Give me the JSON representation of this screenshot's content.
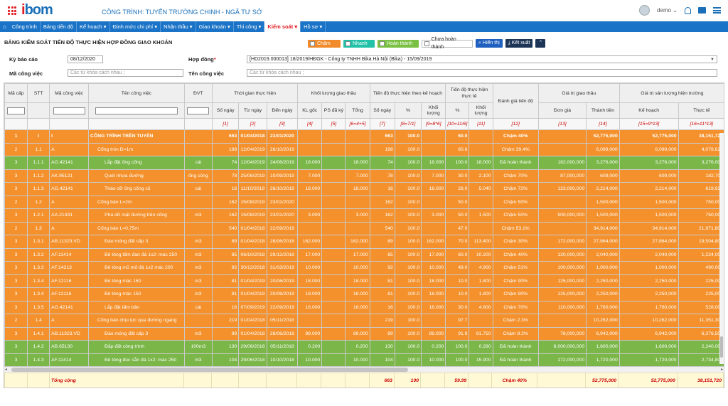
{
  "header": {
    "logo": "bom",
    "logo_prefix": "i",
    "project_title": "CÔNG TRÌNH: TUYẾN TRƯỜNG CHINH - NGÃ TƯ SỞ",
    "user_name": "demo",
    "user_caret": "⌄"
  },
  "nav": {
    "home_icon": "⌂",
    "items": [
      "Công trình",
      "Bảng tiến độ",
      "Kế hoạch ▾",
      "Định mức chi phí ▾",
      "Nhận thầu ▾",
      "Giao khoán ▾",
      "Thi công ▾",
      "Kiểm soát ▾",
      "Hồ sơ ▾"
    ],
    "active_index": 7
  },
  "page": {
    "title": "BẢNG KIỂM SOÁT TIẾN ĐỘ THỰC HIỆN HỢP ĐỒNG GIAO KHOÁN"
  },
  "legend": {
    "late": "Chậm",
    "fast": "Nhanh",
    "done": "Hoàn thành",
    "undone": "Chưa hoàn thành",
    "show_btn": "Hiển thị",
    "export_btn": "Kết xuất",
    "collapse_btn": "⌃",
    "colors": {
      "late": "#f08a2a",
      "fast": "#23c2a8",
      "done": "#7ac143"
    }
  },
  "form": {
    "period_label": "Kỳ báo cáo",
    "period_value": "08/12/2020",
    "contract_label": "Hợp đồng",
    "contract_required": "*",
    "contract_value": "[HD2019.000013] 18/2019/HĐGK - Công ty TNHH Bika Hà Nội (Bika) - 15/09/2019",
    "work_code_label": "Mã công việc",
    "work_code_placeholder": "Các từ khóa cách nhau ;",
    "work_name_label": "Tên công việc",
    "work_name_placeholder": "Các từ khóa cách nhau ;"
  },
  "table": {
    "headers": {
      "level": "Mã cấp",
      "stt": "STT",
      "code": "Mã công việc",
      "name": "Tên công việc",
      "unit": "ĐVT",
      "time": "Thời gian thực hiện",
      "time_days": "Số ngày",
      "time_from": "Từ ngày",
      "time_to": "Đến ngày",
      "qty": "Khối lượng giao thầu",
      "qty_orig": "KL gốc",
      "qty_add": "PS đã ký",
      "qty_total": "Tổng",
      "plan": "Tiến độ thực hiện theo kế hoạch",
      "plan_days": "Số ngày",
      "plan_pct": "%",
      "plan_qty": "Khối lượng",
      "actual": "Tiến độ thực hiện thực tế",
      "actual_pct": "%",
      "actual_qty": "Khối lượng",
      "eval": "Đánh giá tiến độ",
      "value": "Giá trị giao thầu",
      "unit_price": "Đơn giá",
      "amount": "Thành tiền",
      "prod": "Giá trị sản lượng hiện trường",
      "prod_plan": "Kế hoạch",
      "prod_actual": "Thực tế"
    },
    "col_index": [
      "",
      "",
      "",
      "",
      "",
      "[1]",
      "[2]",
      "[3]",
      "[4]",
      "[5]",
      "[6=4+5]",
      "[7]",
      "[8=7/1]",
      "[9=8*6]",
      "[10=11/6]",
      "[11]",
      "[12]",
      "[13]",
      "[14]",
      "[15=9*13]",
      "[16=11*13]"
    ],
    "rows": [
      {
        "s": "orange",
        "b": true,
        "c": [
          "1",
          "I",
          "I",
          "CÔNG TRÌNH TRÊN TUYẾN",
          "",
          "663",
          "01/04/2018",
          "23/01/2020",
          "",
          "",
          "",
          "663",
          "100.0",
          "",
          "60.0",
          "",
          "Chậm 40%",
          "",
          "52,775,000",
          "52,775,000",
          "38,151,720"
        ]
      },
      {
        "s": "orange",
        "c": [
          "2",
          "1.1",
          "A",
          "Cống tròn D=1m",
          "",
          "198",
          "12/04/2019",
          "26/10/2019",
          "",
          "",
          "",
          "198",
          "100.0",
          "",
          "60.6",
          "",
          "Chậm 39.4%",
          "",
          "6,099,000",
          "6,099,000",
          "4,078,620"
        ]
      },
      {
        "s": "green",
        "c": [
          "3",
          "1.1.1",
          "AG.42141",
          "Lắp đặt ống cống",
          "cái",
          "74",
          "12/04/2019",
          "24/06/2019",
          "18.000",
          "",
          "18.000",
          "74",
          "100.0",
          "18.000",
          "100.0",
          "18.000",
          "Đã hoàn thành",
          "182,000,000",
          "3,276,000",
          "3,276,000",
          "3,276,000"
        ]
      },
      {
        "s": "orange",
        "c": [
          "3",
          "1.1.2",
          "AK.95121",
          "Quét nhựa đường",
          "ống cống",
          "78",
          "25/06/2019",
          "10/09/2019",
          "7.000",
          "",
          "7.000",
          "78",
          "100.0",
          "7.000",
          "30.0",
          "2.100",
          "Chậm 70%",
          "87,000,000",
          "609,000",
          "609,000",
          "182,700"
        ]
      },
      {
        "s": "orange",
        "c": [
          "3",
          "1.1.3",
          "AG.42141",
          "Tháo dỡ ống cống cũ",
          "cái",
          "16",
          "11/10/2019",
          "26/10/2019",
          "18.000",
          "",
          "18.000",
          "16",
          "100.0",
          "18.000",
          "28.0",
          "5.040",
          "Chậm 72%",
          "123,000,000",
          "2,214,000",
          "2,214,000",
          "619,920"
        ]
      },
      {
        "s": "orange",
        "c": [
          "2",
          "1.2",
          "A",
          "Cống bản L=2m",
          "",
          "162",
          "15/08/2019",
          "23/01/2020",
          "",
          "",
          "",
          "162",
          "100.0",
          "",
          "50.0",
          "",
          "Chậm 50%",
          "",
          "1,500,000",
          "1,500,000",
          "750,000"
        ]
      },
      {
        "s": "orange",
        "c": [
          "3",
          "1.2.1",
          "AA.21431",
          "Phá dỡ mặt đường trên cống",
          "m3",
          "162",
          "15/08/2019",
          "23/01/2020",
          "3.000",
          "",
          "3.000",
          "162",
          "100.0",
          "3.000",
          "50.0",
          "1.500",
          "Chậm 50%",
          "500,000,000",
          "1,500,000",
          "1,500,000",
          "750,000"
        ]
      },
      {
        "s": "orange",
        "c": [
          "2",
          "1.3",
          "A",
          "Cống bản L=0,75m",
          "",
          "540",
          "01/04/2018",
          "22/09/2019",
          "",
          "",
          "",
          "540",
          "100.0",
          "",
          "47.0",
          "",
          "Chậm 53.1%",
          "",
          "34,914,000",
          "34,914,000",
          "21,971,800"
        ]
      },
      {
        "s": "orange",
        "c": [
          "3",
          "1.3.1",
          "AB.11323.VD",
          "Đào móng đất cấp 3",
          "m3",
          "89",
          "01/04/2018",
          "28/06/2018",
          "162.000",
          "",
          "162.000",
          "89",
          "100.0",
          "162.000",
          "70.0",
          "113.400",
          "Chậm 30%",
          "172,000,000",
          "27,864,000",
          "27,864,000",
          "19,504,800"
        ]
      },
      {
        "s": "orange",
        "c": [
          "3",
          "1.3.2",
          "AF.11414",
          "Bê tông tấm đan đá 1x2: mác 250",
          "m3",
          "85",
          "06/10/2018",
          "29/12/2018",
          "17.000",
          "",
          "17.000",
          "85",
          "100.0",
          "17.000",
          "60.0",
          "10.200",
          "Chậm 40%",
          "120,000,000",
          "2,040,000",
          "2,040,000",
          "1,224,000"
        ]
      },
      {
        "s": "orange",
        "c": [
          "3",
          "1.3.3",
          "AF.14213",
          "Bê tông mũ mố đá 1x2 mác 200",
          "m3",
          "92",
          "30/12/2018",
          "31/03/2019",
          "10.000",
          "",
          "10.000",
          "92",
          "100.0",
          "10.000",
          "49.0",
          "4.900",
          "Chậm 51%",
          "100,000,000",
          "1,000,000",
          "1,000,000",
          "490,000"
        ]
      },
      {
        "s": "orange",
        "c": [
          "3",
          "1.3.4",
          "AF.12116",
          "Bê tông mác 150",
          "m3",
          "81",
          "01/04/2019",
          "20/06/2019",
          "18.000",
          "",
          "18.000",
          "81",
          "100.0",
          "18.000",
          "10.0",
          "1.800",
          "Chậm 90%",
          "125,000,000",
          "2,250,000",
          "2,250,000",
          "225,000"
        ]
      },
      {
        "s": "orange",
        "c": [
          "3",
          "1.3.4",
          "AF.12116",
          "Bê tông mác 150",
          "m3",
          "81",
          "01/04/2019",
          "20/06/2019",
          "18.000",
          "",
          "18.000",
          "81",
          "100.0",
          "18.000",
          "10.0",
          "1.800",
          "Chậm 90%",
          "125,000,000",
          "2,250,000",
          "2,250,000",
          "225,000"
        ]
      },
      {
        "s": "orange",
        "c": [
          "3",
          "1.3.5",
          "AG.42141",
          "Lắp đặt tấm bản",
          "cái",
          "16",
          "07/09/2019",
          "22/09/2019",
          "16.000",
          "",
          "16.000",
          "16",
          "100.0",
          "16.000",
          "30.0",
          "4.800",
          "Chậm 70%",
          "110,000,000",
          "1,760,000",
          "1,760,000",
          "528,000"
        ]
      },
      {
        "s": "orange",
        "c": [
          "2",
          "1.4",
          "A",
          "Cống bản chịu lực qua đường ngang",
          "",
          "219",
          "01/04/2018",
          "05/11/2018",
          "",
          "",
          "",
          "219",
          "100.0",
          "",
          "97.7",
          "",
          "Chậm 2.3%",
          "",
          "10,262,000",
          "10,262,000",
          "11,351,300"
        ]
      },
      {
        "s": "orange",
        "c": [
          "3",
          "1.4.1",
          "AB.11323.VD",
          "Đào móng đất cấp 3",
          "m3",
          "89",
          "01/04/2018",
          "28/06/2018",
          "89.000",
          "",
          "89.000",
          "89",
          "100.0",
          "89.000",
          "91.9",
          "81.750",
          "Chậm 8.2%",
          "78,000,000",
          "6,942,000",
          "6,942,000",
          "6,376,500"
        ]
      },
      {
        "s": "green",
        "c": [
          "3",
          "1.4.2",
          "AB.65130",
          "Đắp đất công trình",
          "100m3",
          "130",
          "29/06/2018",
          "05/11/2018",
          "0.200",
          "",
          "0.200",
          "130",
          "100.0",
          "0.200",
          "100.0",
          "0.280",
          "Đã hoàn thành",
          "8,000,000,000",
          "1,600,000",
          "1,600,000",
          "2,240,000"
        ]
      },
      {
        "s": "green",
        "c": [
          "3",
          "1.4.3",
          "AF.11414",
          "Bê tông đúc sẵn đá 1x2: mác 250",
          "m3",
          "104",
          "29/06/2018",
          "10/10/2018",
          "10.000",
          "",
          "10.000",
          "104",
          "100.0",
          "10.000",
          "100.0",
          "15.900",
          "Đã hoàn thành",
          "172,000,000",
          "1,720,000",
          "1,720,000",
          "2,734,800"
        ]
      }
    ],
    "footer": {
      "label": "Tổng cộng",
      "plan_days": "663",
      "plan_pct": "100",
      "actual_pct": "59.99",
      "eval": "Chậm 40%",
      "amount": "52,775,000",
      "prod_plan": "52,775,000",
      "prod_actual": "38,151,720"
    }
  }
}
